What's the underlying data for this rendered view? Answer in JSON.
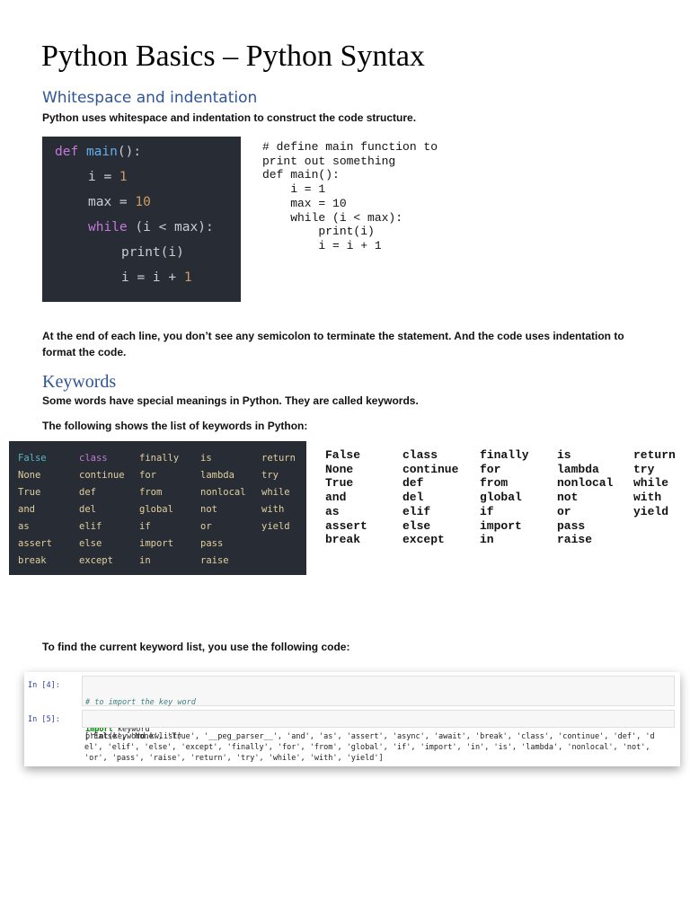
{
  "title": "Python Basics – Python Syntax",
  "section1": {
    "heading": "Whitespace and indentation",
    "intro": "Python uses whitespace and indentation to construct the code structure.",
    "code_image_lines": [
      "def main():",
      "i = 1",
      "max = 10",
      "while (i < max):",
      "print(i)",
      "i = i + 1"
    ],
    "code_text": "# define main function to\nprint out something\ndef main():\n    i = 1\n    max = 10\n    while (i < max):\n        print(i)\n        i = i + 1",
    "after": "At the end of each line, you don’t see any semicolon to terminate the statement. And the code uses indentation to\nformat the code."
  },
  "section2": {
    "heading": "Keywords",
    "p1": "Some words have special meanings in Python. They are called keywords.",
    "p2": "The following shows the list of keywords in Python:",
    "keyword_columns": [
      [
        "False",
        "None",
        "True",
        "and",
        "as",
        "assert",
        "break"
      ],
      [
        "class",
        "continue",
        "def",
        "del",
        "elif",
        "else",
        "except"
      ],
      [
        "finally",
        "for",
        "from",
        "global",
        "if",
        "import",
        "in"
      ],
      [
        "is",
        "lambda",
        "nonlocal",
        "not",
        "or",
        "pass",
        "raise"
      ],
      [
        "return",
        "try",
        "while",
        "with",
        "yield"
      ]
    ],
    "p3": "To find the current keyword list, you use the following code:"
  },
  "notebook": {
    "prompt1": "In [4]:",
    "cell1_comment": "# to import the key word",
    "cell1_code": "import keyword",
    "prompt2": "In [5]:",
    "cell2_code": "print(keyword.kwlist)",
    "output": "['False', 'None', 'True', '__peg_parser__', 'and', 'as', 'assert', 'async', 'await', 'break', 'class', 'continue', 'def', 'd\nel', 'elif', 'else', 'except', 'finally', 'for', 'from', 'global', 'if', 'import', 'in', 'is', 'lambda', 'nonlocal', 'not',\n'or', 'pass', 'raise', 'return', 'try', 'while', 'with', 'yield']"
  },
  "colors": {
    "heading": "#2f5597",
    "code_bg": "#282c34"
  }
}
